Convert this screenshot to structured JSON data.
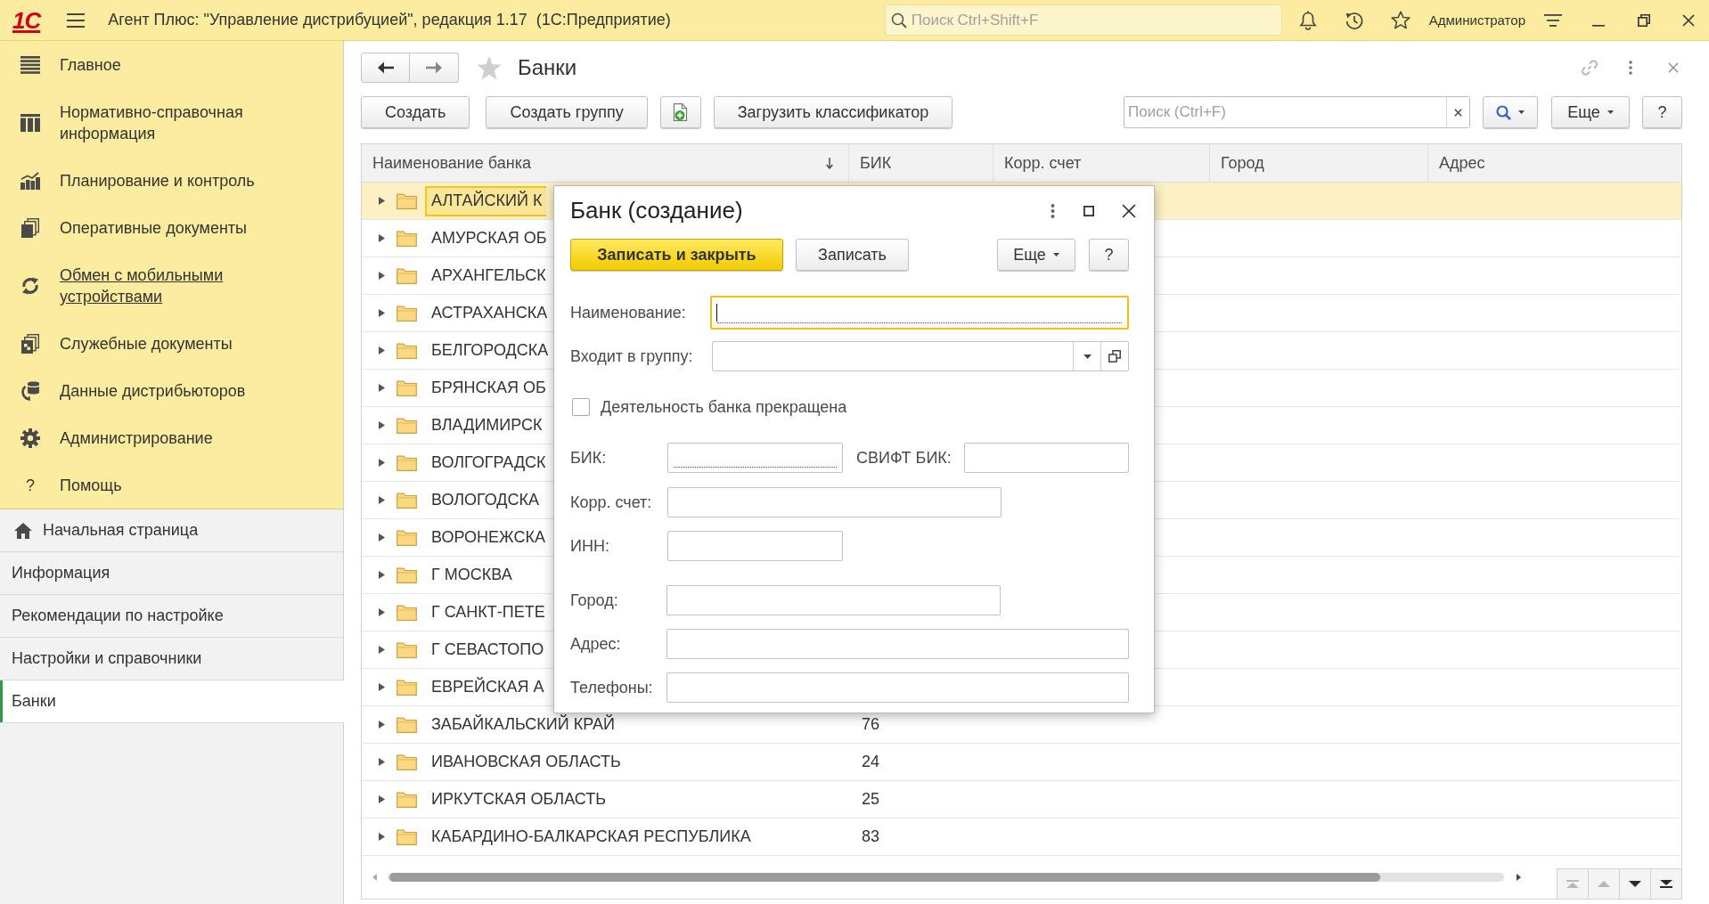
{
  "top_bar": {
    "logo": "1С",
    "title": "Агент Плюс: \"Управление дистрибуцией\", редакция 1.17  (1С:Предприятие)",
    "search": {
      "placeholder": "Поиск Ctrl+Shift+F"
    },
    "user": "Администратор"
  },
  "sections": [
    {
      "label": "Главное",
      "hovered": false
    },
    {
      "label": "Нормативно-справочная информация",
      "hovered": false
    },
    {
      "label": "Планирование и контроль",
      "hovered": false
    },
    {
      "label": "Оперативные документы",
      "hovered": false
    },
    {
      "label": "Обмен с мобильными устройствами",
      "hovered": true
    },
    {
      "label": "Служебные документы",
      "hovered": false
    },
    {
      "label": "Данные дистрибьюторов",
      "hovered": false
    },
    {
      "label": "Администрирование",
      "hovered": false
    },
    {
      "label": "Помощь",
      "glyph": "?",
      "hovered": false
    }
  ],
  "open_pages": [
    {
      "label": "Начальная страница",
      "selected": false
    },
    {
      "label": "Информация",
      "selected": false
    },
    {
      "label": "Рекомендации по настройке",
      "selected": false
    },
    {
      "label": "Настройки и справочники",
      "selected": false
    },
    {
      "label": "Банки",
      "selected": true
    }
  ],
  "form": {
    "title": "Банки",
    "toolbar": {
      "buttons": [
        {
          "kind": "text",
          "label": "Создать"
        },
        {
          "kind": "text",
          "label": "Создать группу"
        },
        {
          "kind": "icon"
        },
        {
          "kind": "text",
          "label": "Загрузить классификатор"
        }
      ],
      "search": {
        "placeholder": "Поиск (Ctrl+F)"
      },
      "more": "Еще",
      "help": "?"
    },
    "table": {
      "columns": [
        {
          "label": "Наименование банка",
          "sorted": true
        },
        {
          "label": "БИК",
          "sorted": false
        },
        {
          "label": "Корр. счет",
          "sorted": false
        },
        {
          "label": "Город",
          "sorted": false
        },
        {
          "label": "Адрес",
          "sorted": false
        }
      ],
      "rows": [
        {
          "name": "АЛТАЙСКИЙ К",
          "selected": true,
          "expanded": false
        },
        {
          "name": "АМУРСКАЯ ОБ",
          "selected": false,
          "expanded": false
        },
        {
          "name": "АРХАНГЕЛЬСК",
          "selected": false,
          "expanded": false
        },
        {
          "name": "АСТРАХАНСКА",
          "selected": false,
          "expanded": false
        },
        {
          "name": "БЕЛГОРОДСКА",
          "selected": false,
          "expanded": false
        },
        {
          "name": "БРЯНСКАЯ ОБ",
          "selected": false,
          "expanded": false
        },
        {
          "name": "ВЛАДИМИРСК",
          "selected": false,
          "expanded": false
        },
        {
          "name": "ВОЛГОГРАДСК",
          "selected": false,
          "expanded": false
        },
        {
          "name": "ВОЛОГОДСКА",
          "selected": false,
          "expanded": false
        },
        {
          "name": "ВОРОНЕЖСКА",
          "selected": false,
          "expanded": false
        },
        {
          "name": "Г МОСКВА",
          "selected": false,
          "expanded": false
        },
        {
          "name": "Г САНКТ-ПЕТЕ",
          "selected": false,
          "expanded": false
        },
        {
          "name": "Г СЕВАСТОПО",
          "selected": false,
          "expanded": false
        },
        {
          "name": "ЕВРЕЙСКАЯ А",
          "selected": false,
          "expanded": false
        },
        {
          "name": "ЗАБАЙКАЛЬСКИЙ КРАЙ",
          "bik": "76",
          "selected": false,
          "expanded": false
        },
        {
          "name": "ИВАНОВСКАЯ ОБЛАСТЬ",
          "bik": "24",
          "selected": false,
          "expanded": false
        },
        {
          "name": "ИРКУТСКАЯ ОБЛАСТЬ",
          "bik": "25",
          "selected": false,
          "expanded": false
        },
        {
          "name": "КАБАРДИНО-БАЛКАРСКАЯ РЕСПУБЛИКА",
          "bik": "83",
          "selected": false,
          "expanded": false
        }
      ],
      "scroll_buttons": [
        {
          "disabled": true
        },
        {
          "disabled": true
        },
        {
          "disabled": false
        },
        {
          "disabled": false
        }
      ]
    }
  },
  "dialog": {
    "title": "Банк (создание)",
    "buttons": [
      {
        "kind": "primary",
        "label": "Записать и закрыть"
      },
      {
        "kind": "default",
        "label": "Записать"
      },
      {
        "kind": "menu",
        "label": "Еще"
      },
      {
        "kind": "default",
        "label": "?"
      }
    ],
    "fields": [
      {
        "kind": "text",
        "label": "Наименование:",
        "required": true,
        "focused": true
      },
      {
        "kind": "select",
        "label": "Входит в группу:",
        "required": false,
        "focused": false
      },
      {
        "kind": "checkbox",
        "label": "Деятельность банка прекращена",
        "checked": false
      },
      {
        "kind": "text",
        "label": "БИК:",
        "required": true,
        "focused": false
      },
      {
        "kind": "text",
        "label": "СВИФТ БИК:",
        "required": false,
        "focused": false
      },
      {
        "kind": "text",
        "label": "Корр. счет:",
        "required": false,
        "focused": false
      },
      {
        "kind": "text",
        "label": "ИНН:",
        "required": false,
        "focused": false
      },
      {
        "kind": "text",
        "label": "Город:",
        "required": false,
        "focused": false
      },
      {
        "kind": "text",
        "label": "Адрес:",
        "required": false,
        "focused": false
      },
      {
        "kind": "text",
        "label": "Телефоны:",
        "required": false,
        "focused": false
      }
    ]
  }
}
